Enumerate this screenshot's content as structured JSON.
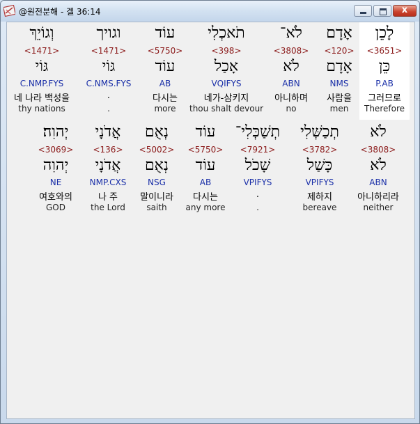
{
  "window": {
    "title": "@원전분해 - 겔 36:14",
    "app_icon": "book-icon",
    "buttons": {
      "minimize": "minimize-icon",
      "maximize": "maximize-icon",
      "close": "close-icon",
      "close_glyph": "x"
    }
  },
  "colors": {
    "strong": "#8b1a1a",
    "parse": "#1a2fa8",
    "highlight": "#ffffff"
  },
  "verse": {
    "row1": [
      {
        "hebrew": "וְגוֹיֵךְ",
        "strong": "<1471>",
        "lemma": "גּוֹי",
        "parse": "C.NMP.FYS",
        "korean": "네 나라 백성을",
        "english": "thy nations"
      },
      {
        "hebrew": "וגויך",
        "strong": "<1471>",
        "lemma": "גּוֹי",
        "parse": "C.NMS.FYS",
        "korean": ".",
        "english": "."
      },
      {
        "hebrew": "עוֹד",
        "strong": "<5750>",
        "lemma": "עוֹד",
        "parse": "AB",
        "korean": "다시는",
        "english": "more"
      },
      {
        "hebrew": "תֹאכְלִי",
        "strong": "<398>",
        "lemma": "אָכַל",
        "parse": "VQIFYS",
        "korean": "네가-삼키지",
        "english": "thou shalt devour"
      },
      {
        "hebrew": "לֹא־",
        "strong": "<3808>",
        "lemma": "לֹא",
        "parse": "ABN",
        "korean": "아니하며",
        "english": "no"
      },
      {
        "hebrew": "אָדָם",
        "strong": "<120>",
        "lemma": "אָדָם",
        "parse": "NMS",
        "korean": "사람을",
        "english": "men"
      },
      {
        "hebrew": "לָכֵן",
        "strong": "<3651>",
        "lemma": "כֵּן",
        "parse": "P.AB",
        "korean": "그러므로",
        "english": "Therefore"
      }
    ],
    "row2": [
      {
        "hebrew": "יְהוִה׃",
        "strong": "<3069>",
        "lemma": "יְהוִה",
        "parse": "NE",
        "korean": "여호와의",
        "english": "GOD"
      },
      {
        "hebrew": "אֲדֹנָי",
        "strong": "<136>",
        "lemma": "אֲדֹנָי",
        "parse": "NMP.CXS",
        "korean": "나 주",
        "english": "the Lord"
      },
      {
        "hebrew": "נְאֻם",
        "strong": "<5002>",
        "lemma": "נְאֻם",
        "parse": "NSG",
        "korean": "말이니라",
        "english": "saith"
      },
      {
        "hebrew": "עוֹד",
        "strong": "<5750>",
        "lemma": "עוֹד",
        "parse": "AB",
        "korean": "다시는",
        "english": "any more"
      },
      {
        "hebrew": "תְשַׁכְּלִי־",
        "strong": "<7921>",
        "lemma": "שָׁכֹל",
        "parse": "VPIFYS",
        "korean": ".",
        "english": "."
      },
      {
        "hebrew": "תְכַשְּׁלִי",
        "strong": "<3782>",
        "lemma": "כָּשַׁל",
        "parse": "VPIFYS",
        "korean": "제하지",
        "english": "bereave"
      },
      {
        "hebrew": "לֹא",
        "strong": "<3808>",
        "lemma": "לֹא",
        "parse": "ABN",
        "korean": "아니하리라",
        "english": "neither"
      }
    ]
  }
}
